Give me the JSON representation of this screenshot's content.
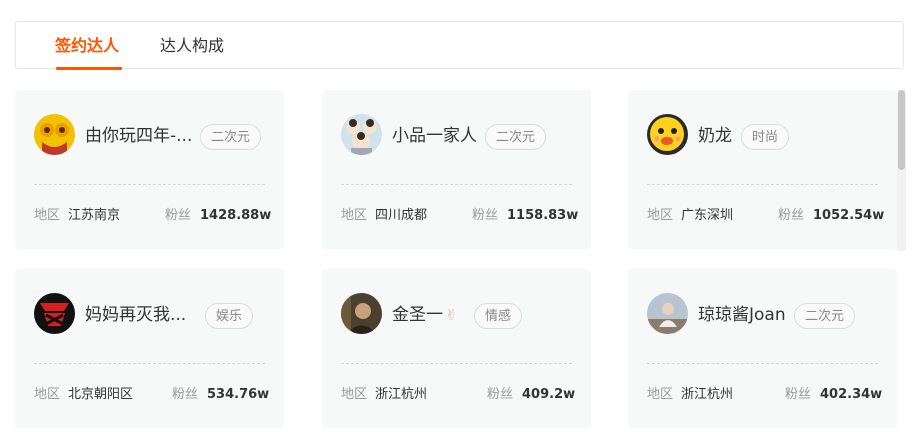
{
  "tabs": [
    {
      "label": "签约达人",
      "active": true
    },
    {
      "label": "达人构成",
      "active": false
    }
  ],
  "labels": {
    "region": "地区",
    "fans": "粉丝"
  },
  "accent_color": "#ff5500",
  "influencers": [
    {
      "name": "由你玩四年-...",
      "tag": "二次元",
      "region": "江苏南京",
      "fans": "1428.88w",
      "avatar": "yellow-cartoon-avatar"
    },
    {
      "name": "小品一家人",
      "tag": "二次元",
      "region": "四川成都",
      "fans": "1158.83w",
      "avatar": "family-cartoon-avatar"
    },
    {
      "name": "奶龙",
      "tag": "时尚",
      "region": "广东深圳",
      "fans": "1052.54w",
      "avatar": "yellow-dragon-avatar"
    },
    {
      "name": "妈妈再灭我...",
      "tag": "娱乐",
      "region": "北京朝阳区",
      "fans": "534.76w",
      "avatar": "red-logo-avatar"
    },
    {
      "name": "金圣一",
      "tag": "情感",
      "region": "浙江杭州",
      "fans": "409.2w",
      "avatar": "photo-avatar",
      "emoji": "✌"
    },
    {
      "name": "琼琼酱Joan",
      "tag": "二次元",
      "region": "浙江杭州",
      "fans": "402.34w",
      "avatar": "photo-avatar-2"
    }
  ]
}
